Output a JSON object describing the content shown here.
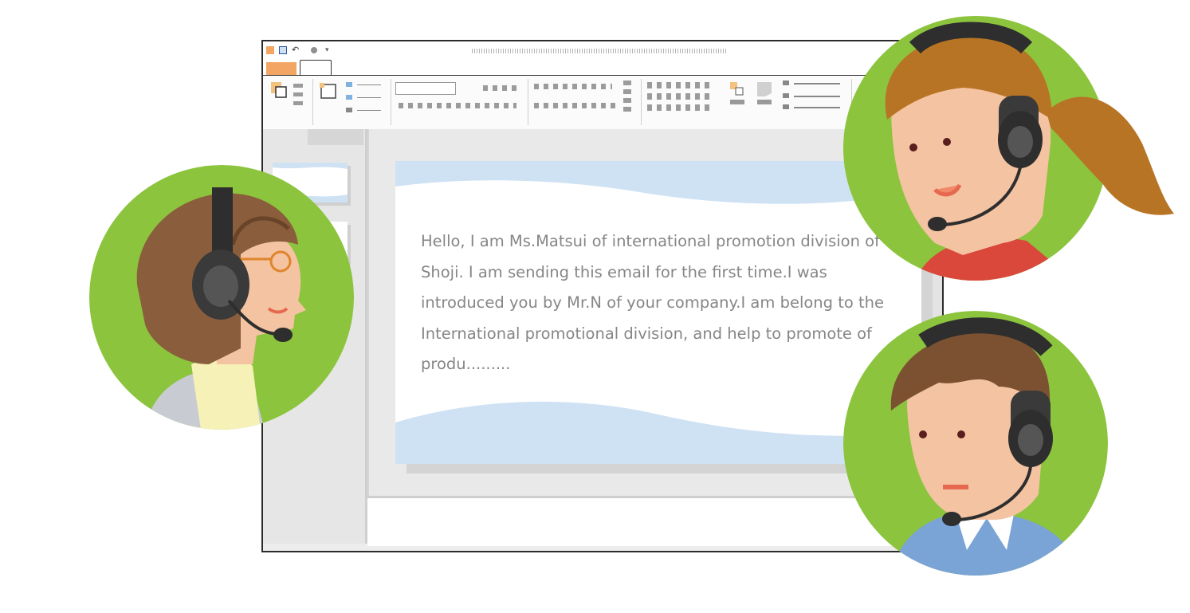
{
  "slide": {
    "body_text": "Hello, I am Ms.Matsui of international promotion division of Shoji. I am sending this email for the first time.I was introduced you by Mr.N of your company.I am belong to the International promotional division, and help to promote of produ........."
  },
  "colors": {
    "accent_tab": "#f3a664",
    "avatar_background": "#8cc43d",
    "slide_wave": "#cfe2f4",
    "text_gray": "#868686"
  },
  "icons": [
    "app-icon",
    "save-icon",
    "undo-icon",
    "customize-icon",
    "headset-icon"
  ]
}
